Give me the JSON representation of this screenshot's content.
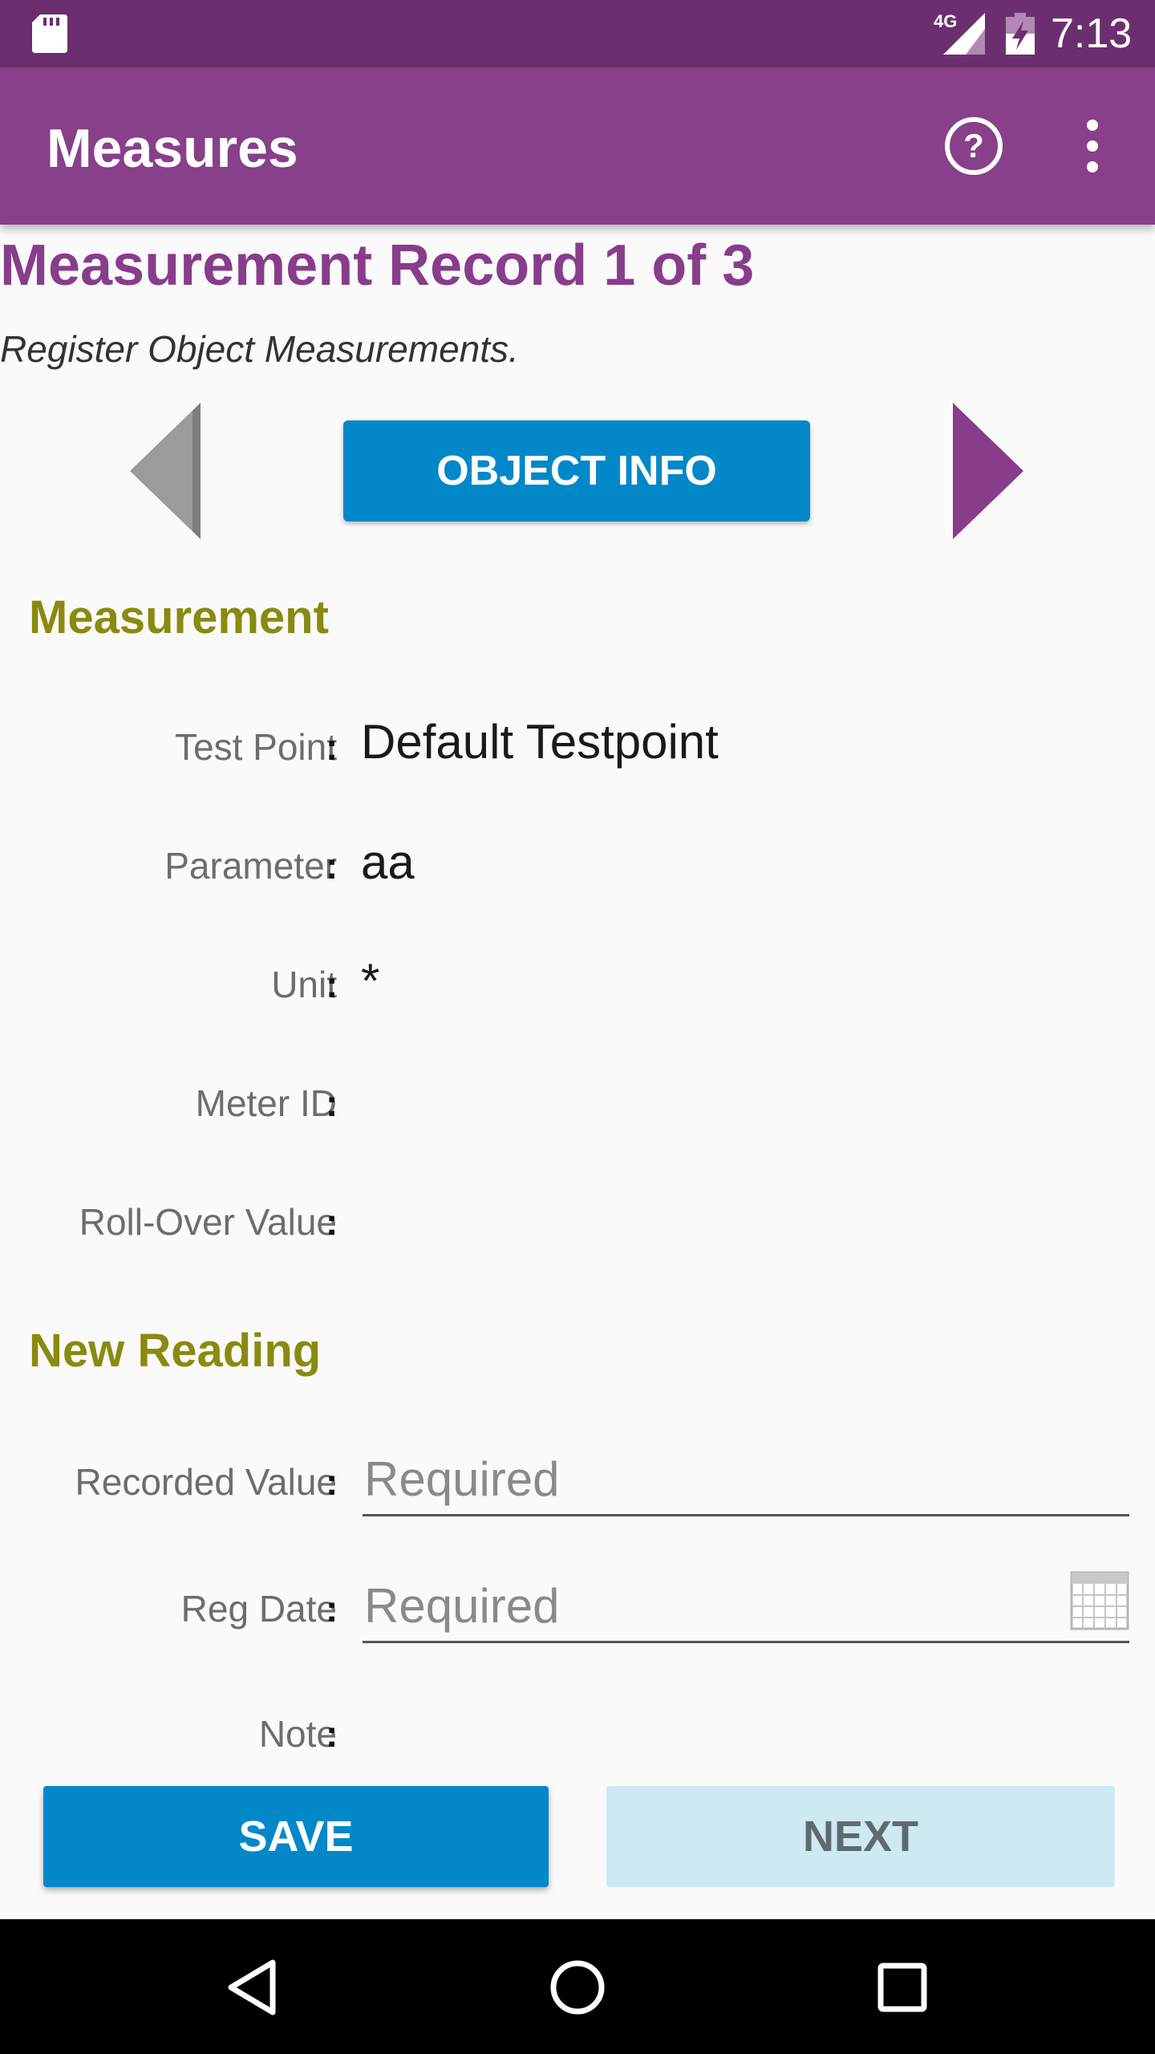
{
  "status_bar": {
    "network": "4G",
    "time": "7:13",
    "icons": [
      "sd-card-icon",
      "signal-icon",
      "battery-charging-icon"
    ]
  },
  "app_bar": {
    "title": "Measures",
    "actions": [
      "help-icon",
      "overflow-menu-icon"
    ]
  },
  "record": {
    "title": "Measurement Record 1 of 3",
    "subtitle": "Register Object Measurements."
  },
  "nav_controls": {
    "object_info_label": "OBJECT INFO",
    "prev_state": "disabled",
    "next_state": "enabled"
  },
  "measurement": {
    "heading": "Measurement",
    "fields": [
      {
        "label": "Test Point",
        "value": "Default Testpoint"
      },
      {
        "label": "Parameter",
        "value": "aa"
      },
      {
        "label": "Unit",
        "value": "*"
      },
      {
        "label": "Meter ID",
        "value": ""
      },
      {
        "label": "Roll-Over Value",
        "value": ""
      }
    ]
  },
  "new_reading": {
    "heading": "New Reading",
    "recorded_value": {
      "label": "Recorded Value",
      "value": "",
      "placeholder": "Required"
    },
    "reg_date": {
      "label": "Reg Date",
      "value": "",
      "placeholder": "Required"
    },
    "note": {
      "label": "Note",
      "value": ""
    }
  },
  "actions": {
    "save_label": "SAVE",
    "next_label": "NEXT"
  },
  "colors": {
    "status_bar": "#6b2f70",
    "app_bar": "#874089",
    "title": "#883d8b",
    "section_heading": "#8a8a10",
    "primary_button": "#0288c8",
    "secondary_button": "#cde9f2"
  },
  "system_nav": [
    "back-icon",
    "home-icon",
    "recents-icon"
  ]
}
